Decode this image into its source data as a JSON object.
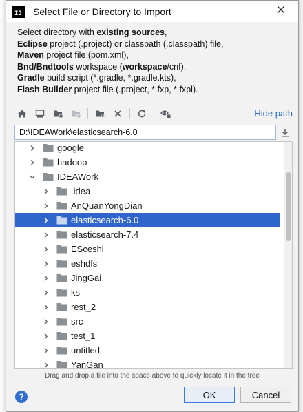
{
  "dialog": {
    "title": "Select File or Directory to Import",
    "logo_text": "IJ"
  },
  "description": {
    "line1_pre": "Select directory with ",
    "line1_bold": "existing sources",
    "line1_post": ",",
    "line2_bold": "Eclipse",
    "line2_post": " project (.project) or classpath (.classpath) file,",
    "line3_bold": "Maven",
    "line3_post": " project file (pom.xml),",
    "line4_bold": "Bnd/Bndtools",
    "line4_mid": " workspace (",
    "line4_bold2": "workspace",
    "line4_post": "/cnf),",
    "line5_bold": "Gradle",
    "line5_post": " build script (*.gradle, *.gradle.kts),",
    "line6_bold": "Flash Builder",
    "line6_post": " project file (.project, *.fxp, *.fxpl)."
  },
  "toolbar": {
    "icons": [
      "home-icon",
      "desktop-icon",
      "project-folder-icon",
      "module-folder-icon",
      "new-folder-icon",
      "delete-icon",
      "refresh-icon",
      "show-hidden-icon"
    ],
    "hide_path_label": "Hide path"
  },
  "path": {
    "value": "D:\\IDEAWork\\elasticsearch-6.0"
  },
  "tree": {
    "items": [
      {
        "label": "google",
        "depth": 1,
        "expanded": false,
        "selected": false
      },
      {
        "label": "hadoop",
        "depth": 1,
        "expanded": false,
        "selected": false
      },
      {
        "label": "IDEAWork",
        "depth": 1,
        "expanded": true,
        "selected": false
      },
      {
        "label": ".idea",
        "depth": 2,
        "expanded": false,
        "selected": false
      },
      {
        "label": "AnQuanYongDian",
        "depth": 2,
        "expanded": false,
        "selected": false
      },
      {
        "label": "elasticsearch-6.0",
        "depth": 2,
        "expanded": false,
        "selected": true
      },
      {
        "label": "elasticsearch-7.4",
        "depth": 2,
        "expanded": false,
        "selected": false
      },
      {
        "label": "ESceshi",
        "depth": 2,
        "expanded": false,
        "selected": false
      },
      {
        "label": "eshdfs",
        "depth": 2,
        "expanded": false,
        "selected": false
      },
      {
        "label": "JingGai",
        "depth": 2,
        "expanded": false,
        "selected": false
      },
      {
        "label": "ks",
        "depth": 2,
        "expanded": false,
        "selected": false
      },
      {
        "label": "rest_2",
        "depth": 2,
        "expanded": false,
        "selected": false
      },
      {
        "label": "src",
        "depth": 2,
        "expanded": false,
        "selected": false
      },
      {
        "label": "test_1",
        "depth": 2,
        "expanded": false,
        "selected": false
      },
      {
        "label": "untitled",
        "depth": 2,
        "expanded": false,
        "selected": false
      },
      {
        "label": "YanGan",
        "depth": 2,
        "expanded": false,
        "selected": false
      }
    ]
  },
  "hint": "Drag and drop a file into the space above to quickly locate it in the tree",
  "footer": {
    "help_label": "?",
    "ok_label": "OK",
    "cancel_label": "Cancel"
  },
  "colors": {
    "selection": "#2f65ca",
    "link": "#2a6ec9",
    "folder": "#8a8f94"
  }
}
